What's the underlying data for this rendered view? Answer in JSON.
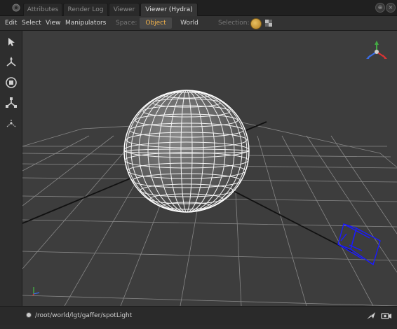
{
  "tabs": [
    {
      "label": "Attributes",
      "active": false
    },
    {
      "label": "Render Log",
      "active": false
    },
    {
      "label": "Viewer",
      "active": false
    },
    {
      "label": "Viewer (Hydra)",
      "active": true
    }
  ],
  "menu": {
    "edit": "Edit",
    "select": "Select",
    "view": "View",
    "manipulators": "Manipulators"
  },
  "space": {
    "label": "Space:",
    "options": [
      "Object",
      "World"
    ],
    "selected": "Object"
  },
  "selection": {
    "label": "Selection:"
  },
  "left_tools": [
    "select-arrow-icon",
    "translate-icon",
    "rotate-icon",
    "scale-icon",
    "light-manipulator-icon"
  ],
  "status": {
    "path": "/root/world/lgt/gaffer/spotLight"
  },
  "colors": {
    "accent": "#f2b24a",
    "viewport_bg": "#3d3d3d",
    "wireframe": "#ffffff",
    "light_selected": "#1a1aff"
  }
}
